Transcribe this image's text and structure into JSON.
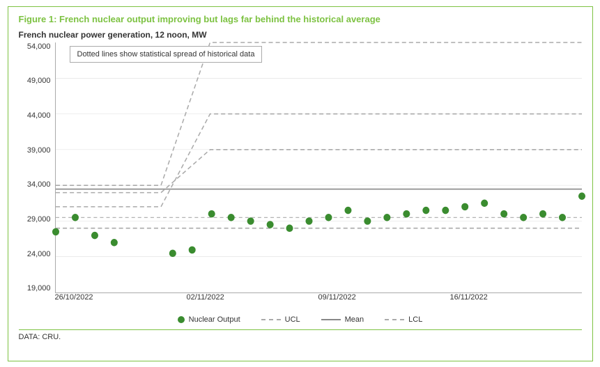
{
  "figure": {
    "title": "Figure 1: French nuclear output improving but lags far behind the historical average",
    "subtitle": "French nuclear power generation, 12 noon, MW",
    "tooltip": "Dotted lines show statistical spread of historical data",
    "data_source": "DATA: CRU.",
    "y_axis": {
      "labels": [
        "54,000",
        "49,000",
        "44,000",
        "39,000",
        "34,000",
        "29,000",
        "24,000",
        "19,000"
      ]
    },
    "x_axis": {
      "labels": [
        "26/10/2022",
        "02/11/2022",
        "09/11/2022",
        "16/11/2022"
      ]
    },
    "legend": {
      "nuclear_output": "Nuclear Output",
      "ucl": "UCL",
      "mean": "Mean",
      "lcl": "LCL"
    },
    "colors": {
      "green": "#3a8c2f",
      "title_green": "#7dc242",
      "gray": "#aaa",
      "dark_gray": "#888"
    }
  }
}
